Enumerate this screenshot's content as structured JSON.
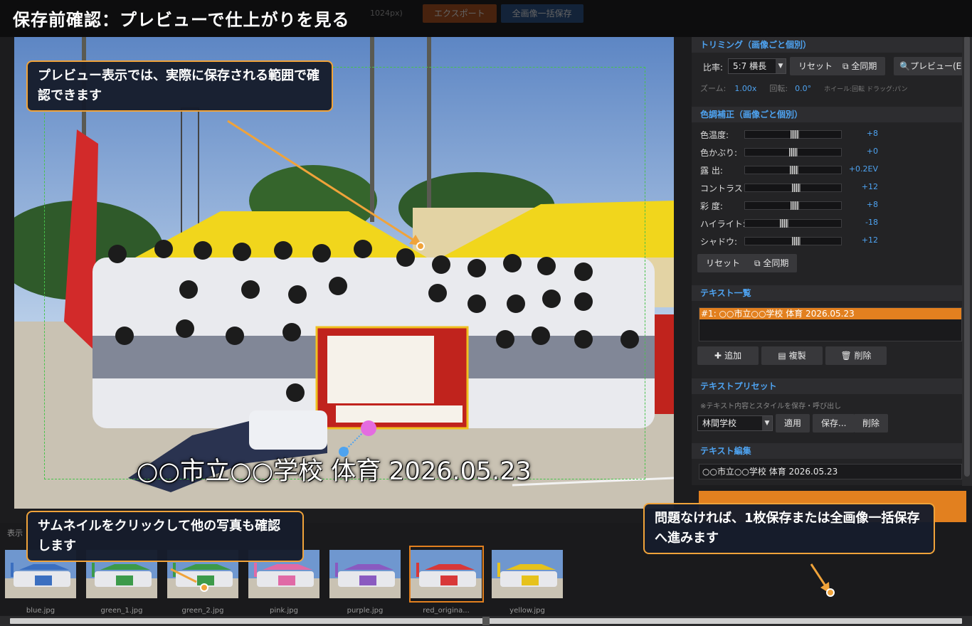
{
  "banner": {
    "title": "保存前確認：プレビューで仕上がりを見る",
    "ghost_size": "1024px)",
    "ghost_export": "エクスポート",
    "ghost_saveall": "全画像一括保存"
  },
  "preview": {
    "overlay_text": "○○市立○○学校  体育  2026.05.23"
  },
  "panel": {
    "trim": {
      "header": "トリミング（画像ごと個別）",
      "ratio_label": "比率:",
      "ratio_value": "5:7 横長",
      "reset": "リセット",
      "sync_all": "全同期",
      "preview": "プレビュー(Enter)",
      "zoom_label": "ズーム:",
      "zoom_value": "1.00x",
      "rotate_label": "回転:",
      "rotate_value": "0.0°",
      "hint": "ホイール:回転  ドラッグ:パン"
    },
    "color": {
      "header": "色調補正（画像ごと個別）",
      "sliders": [
        {
          "label": "色温度:",
          "value": "+8",
          "pos": 0.52
        },
        {
          "label": "色かぶり:",
          "value": "+0",
          "pos": 0.5
        },
        {
          "label": "露 出:",
          "value": "+0.2EV",
          "pos": 0.51
        },
        {
          "label": "コントラスト:",
          "value": "+12",
          "pos": 0.53
        },
        {
          "label": "彩 度:",
          "value": "+8",
          "pos": 0.52
        },
        {
          "label": "ハイライト:",
          "value": "-18",
          "pos": 0.41
        },
        {
          "label": "シャドウ:",
          "value": "+12",
          "pos": 0.53
        }
      ],
      "reset": "リセット",
      "sync_all": "全同期"
    },
    "textlist": {
      "header": "テキスト一覧",
      "item": "#1: ○○市立○○学校  体育  2026.05.23",
      "add": "追加",
      "duplicate": "複製",
      "delete": "削除"
    },
    "preset": {
      "header": "テキストプリセット",
      "note": "※テキスト内容とスタイルを保存・呼び出し",
      "selected": "林間学校",
      "apply": "適用",
      "save": "保存...",
      "delete": "削除"
    },
    "edit": {
      "header": "テキスト編集",
      "value": "○○市立○○学校  体育  2026.05.23"
    }
  },
  "strip": {
    "label": "表示",
    "thumbs": [
      {
        "name": "blue.jpg",
        "color": "#3b6fc0"
      },
      {
        "name": "green_1.jpg",
        "color": "#3c9a4a"
      },
      {
        "name": "green_2.jpg",
        "color": "#3c9a4a"
      },
      {
        "name": "pink.jpg",
        "color": "#e06aa6"
      },
      {
        "name": "purple.jpg",
        "color": "#8a5ac0"
      },
      {
        "name": "red_origina...",
        "color": "#d83838"
      },
      {
        "name": "yellow.jpg",
        "color": "#e6c21c"
      }
    ]
  },
  "callouts": {
    "preview_note": "プレビュー表示では、実際に保存される範囲で確認できます",
    "thumb_note": "サムネイルをクリックして他の写真も確認します",
    "save_note": "問題なければ、1枚保存または全画像一括保存へ進みます"
  },
  "colors": {
    "accent_orange": "#e2801f",
    "panel_blue": "#4ea3f1",
    "callout_border": "#f0a33a"
  }
}
